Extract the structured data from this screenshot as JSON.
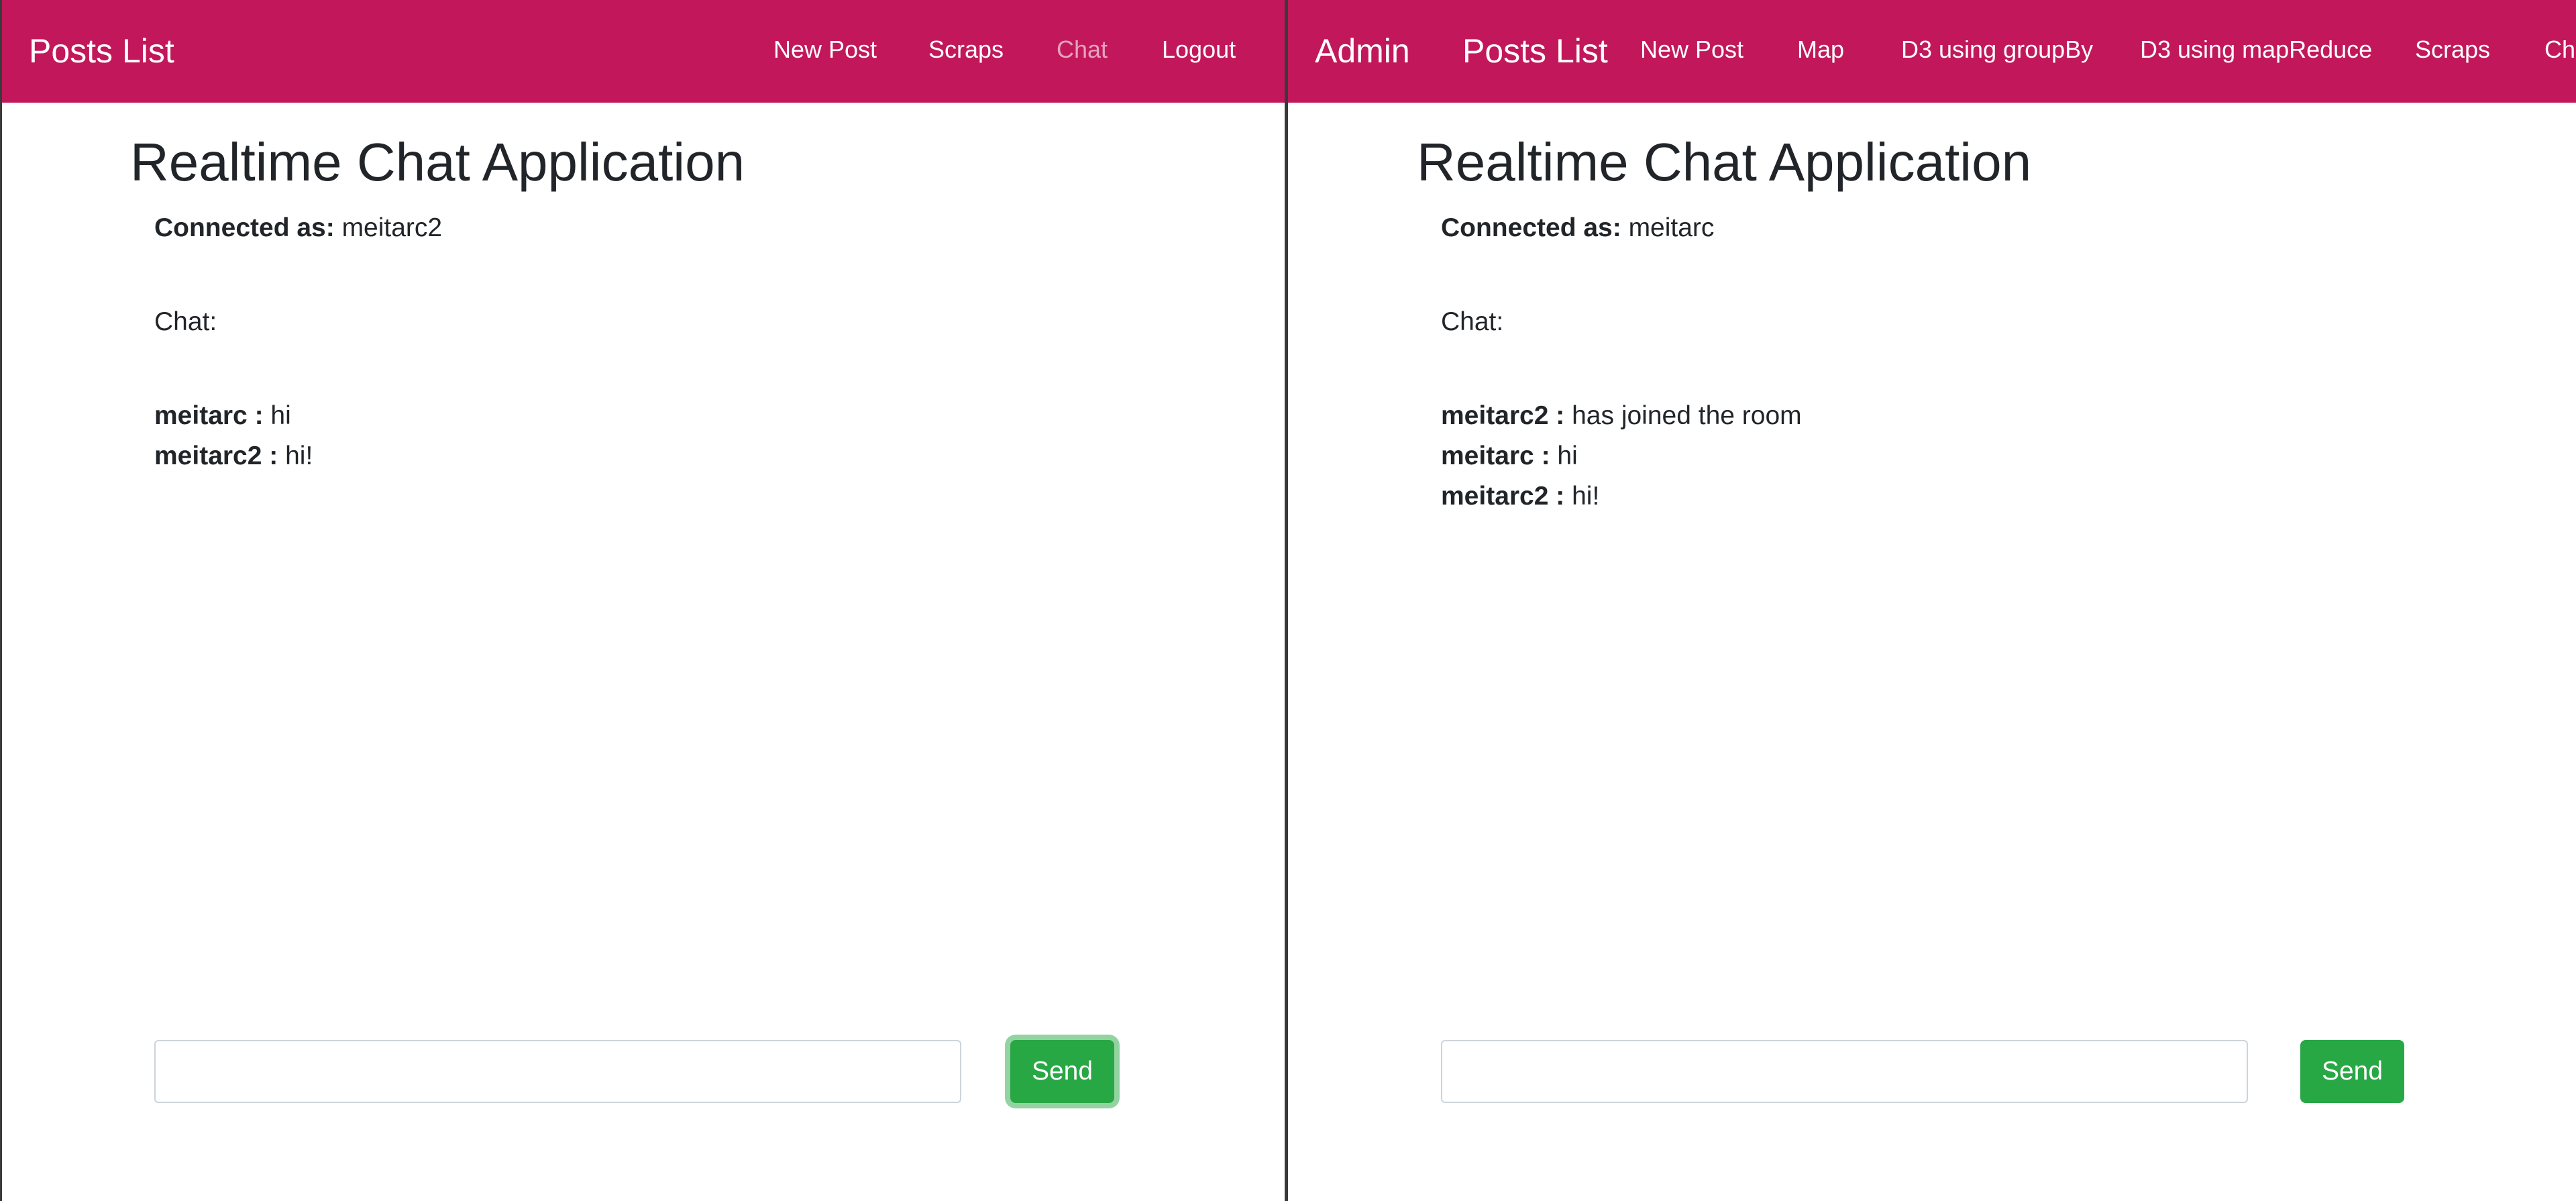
{
  "left_window": {
    "navbar": {
      "brand": "Posts List",
      "links": [
        "New Post",
        "Scraps",
        "Chat",
        "Logout"
      ],
      "active_link": "Chat"
    },
    "page_title": "Realtime Chat Application",
    "connected_label": "Connected as:",
    "connected_user": "meitarc2",
    "chat_label": "Chat:",
    "messages": [
      {
        "user": "meitarc :",
        "text": "hi"
      },
      {
        "user": "meitarc2 :",
        "text": "hi!"
      }
    ],
    "input_value": "",
    "send_label": "Send"
  },
  "right_window": {
    "navbar": {
      "brand": "Admin",
      "brand2": "Posts List",
      "links": [
        "New Post",
        "Map",
        "D3 using groupBy",
        "D3 using mapReduce",
        "Scraps",
        "Ch"
      ]
    },
    "page_title": "Realtime Chat Application",
    "connected_label": "Connected as:",
    "connected_user": "meitarc",
    "chat_label": "Chat:",
    "messages": [
      {
        "user": "meitarc2 :",
        "text": "has joined the room"
      },
      {
        "user": "meitarc :",
        "text": "hi"
      },
      {
        "user": "meitarc2 :",
        "text": "hi!"
      }
    ],
    "input_value": "",
    "send_label": "Send"
  },
  "colors": {
    "navbar_bg": "#c2185b",
    "send_button": "#28a745",
    "text": "#212529"
  }
}
